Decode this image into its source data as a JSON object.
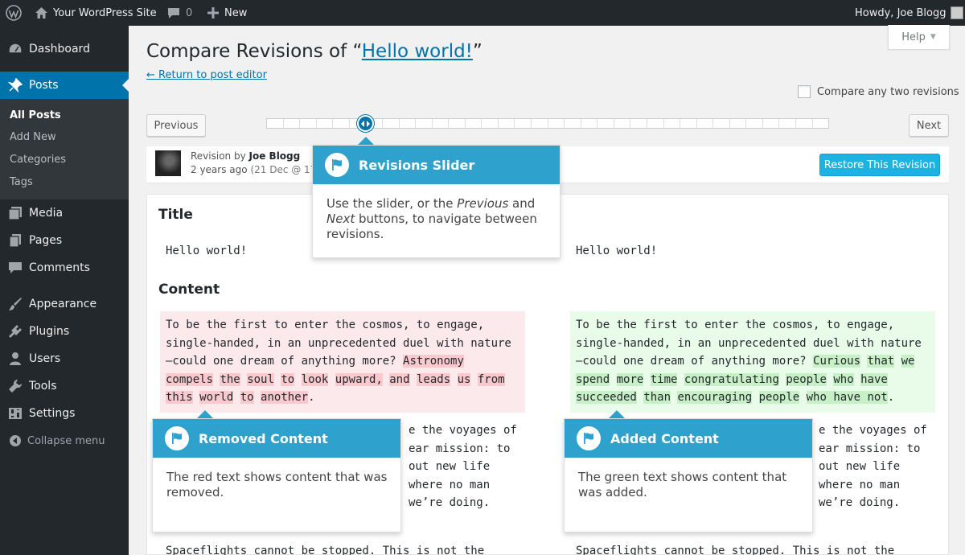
{
  "adminbar": {
    "site_name": "Your WordPress Site",
    "comments_count": "0",
    "new_label": "New",
    "howdy": "Howdy, Joe Blogg"
  },
  "sidebar": {
    "items": [
      {
        "label": "Dashboard",
        "icon": "dashboard-icon"
      },
      {
        "label": "Posts",
        "icon": "pushpin-icon"
      },
      {
        "label": "Media",
        "icon": "media-icon"
      },
      {
        "label": "Pages",
        "icon": "pages-icon"
      },
      {
        "label": "Comments",
        "icon": "comment-icon"
      },
      {
        "label": "Appearance",
        "icon": "paintbrush-icon"
      },
      {
        "label": "Plugins",
        "icon": "plugin-icon"
      },
      {
        "label": "Users",
        "icon": "users-icon"
      },
      {
        "label": "Tools",
        "icon": "wrench-icon"
      },
      {
        "label": "Settings",
        "icon": "settings-icon"
      },
      {
        "label": "Collapse menu",
        "icon": "collapse-icon"
      }
    ],
    "submenu": [
      "All Posts",
      "Add New",
      "Categories",
      "Tags"
    ]
  },
  "header": {
    "help_label": "Help",
    "title_prefix": "Compare Revisions of “",
    "title_link": "Hello world!",
    "title_suffix": "”",
    "return_link": "← Return to post editor",
    "compare_two_label": "Compare any two revisions"
  },
  "nav": {
    "previous_label": "Previous",
    "next_label": "Next"
  },
  "revision": {
    "by_prefix": "Revision by",
    "author": "Joe Blogg",
    "ago": "2 years ago",
    "date": "(21 Dec @ 17:4",
    "restore_label": "Restore This Revision"
  },
  "diff": {
    "title_heading": "Title",
    "content_heading": "Content",
    "left_title": "Hello world!",
    "right_title": "Hello world!",
    "left_content_line1": "To be the first to enter the cosmos, to engage,",
    "left_content_line2": "single-handed, in an unprecedented duel with nature",
    "left_content_line3_plain": "—could one dream of anything more? ",
    "left_removed_words": [
      "Astronomy",
      "compels",
      "the",
      "soul",
      "to",
      "look",
      "upward,",
      "and",
      "leads",
      "us",
      "from",
      "this",
      "world",
      "to",
      "another"
    ],
    "right_content_line1": "To be the first to enter the cosmos, to engage,",
    "right_content_line2": "single-handed, in an unprecedented duel with nature",
    "right_content_line3_plain": "—could one dream of anything more? ",
    "right_added_words": [
      "Curious",
      "that",
      "we",
      "spend",
      "more",
      "time",
      "congratulating",
      "people",
      "who",
      "have",
      "succeeded",
      "than",
      "encouraging",
      "people",
      "who have not"
    ],
    "period": ".",
    "left_under": [
      "e the voyages of",
      "ear mission: to",
      "out new life",
      "where no man",
      "we’re doing."
    ],
    "right_under": [
      "e the voyages of",
      "ear mission: to",
      "out new life",
      "where no man",
      "we’re doing."
    ],
    "bottom_line": "Spaceflights cannot be stopped. This is not the"
  },
  "callouts": {
    "slider": {
      "title": "Revisions Slider",
      "body_1": "Use the slider, or the ",
      "body_prev": "Previous",
      "body_2": " and",
      "body_next": "Next",
      "body_3": " buttons, to navigate between revisions."
    },
    "removed": {
      "title": "Removed Content",
      "body": "The red text shows content that was removed."
    },
    "added": {
      "title": "Added Content",
      "body": "The green text shows content that was added."
    }
  },
  "colors": {
    "admin_dark": "#23282d",
    "accent_blue": "#0073aa",
    "callout_blue": "#2ea2cc",
    "restore_blue": "#1cb2e2",
    "removed_bg": "#fbe9eb",
    "removed_word": "#f9c9cd",
    "added_bg": "#e9fbe9",
    "added_word": "#c7f0c6"
  }
}
